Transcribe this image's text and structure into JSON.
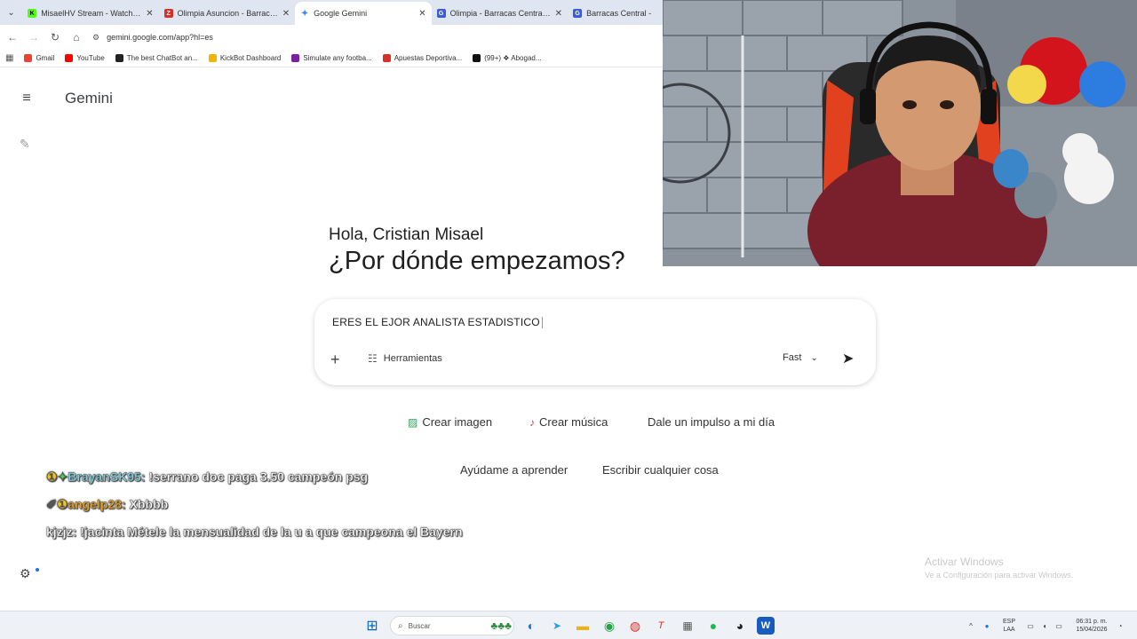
{
  "browser": {
    "tabs": [
      {
        "title": "MisaelHV Stream - Watch Live ",
        "color": "#53fc18",
        "active": false
      },
      {
        "title": "Olimpia Asuncion - Barracas Ce",
        "color": "#d93025",
        "active": false
      },
      {
        "title": "Google Gemini",
        "color": "#4285f4",
        "active": true
      },
      {
        "title": "Olimpia - Barracas Central en v",
        "color": "#3c5bd6",
        "active": false
      },
      {
        "title": "Barracas Central - ",
        "color": "#3c5bd6",
        "active": false
      }
    ],
    "url": "gemini.google.com/app?hl=es",
    "bookmarks": [
      {
        "label": "Gmail",
        "color": "#ea4335"
      },
      {
        "label": "YouTube",
        "color": "#ff0000"
      },
      {
        "label": "The best ChatBot an...",
        "color": "#222222"
      },
      {
        "label": "KickBot Dashboard",
        "color": "#f4b400"
      },
      {
        "label": "Simulate any footba...",
        "color": "#7b1fa2"
      },
      {
        "label": "Apuestas Deportiva...",
        "color": "#d93025"
      },
      {
        "label": "(99+) ❖ Abogad...",
        "color": "#111111"
      }
    ]
  },
  "gemini": {
    "brand": "Gemini",
    "greeting": "Hola, Cristian Misael",
    "headline": "¿Por dónde empezamos?",
    "prompt_value": "ERES EL EJOR ANALISTA ESTADISTICO",
    "tools_label": "Herramientas",
    "model_label": "Fast",
    "chips": {
      "create_image": "Crear imagen",
      "create_music": "Crear música",
      "boost_day": "Dale un impulso a mi día",
      "help_learn": "Ayúdame a aprender",
      "write_anything": "Escribir cualquier cosa"
    }
  },
  "chat": [
    {
      "user": "BrayanSK95:",
      "message": "!serrano doc paga 3.50 campeón psg",
      "user_color": "#7fd6e6"
    },
    {
      "user": "angelp28:",
      "message": "Xbbbb",
      "user_color": "#f2a31a"
    },
    {
      "user": "kjzjz:",
      "message": "!jacinta Métele la mensualidad de la u a que campeona el Bayern",
      "user_color": "#ffffff"
    }
  ],
  "watermark": {
    "title": "Activar Windows",
    "subtitle": "Ve a Configuración para activar Windows."
  },
  "taskbar": {
    "search_placeholder": "Buscar",
    "language": "ESP",
    "layout": "LAA",
    "time": "06:31 p. m.",
    "date": "15/04/2026"
  }
}
